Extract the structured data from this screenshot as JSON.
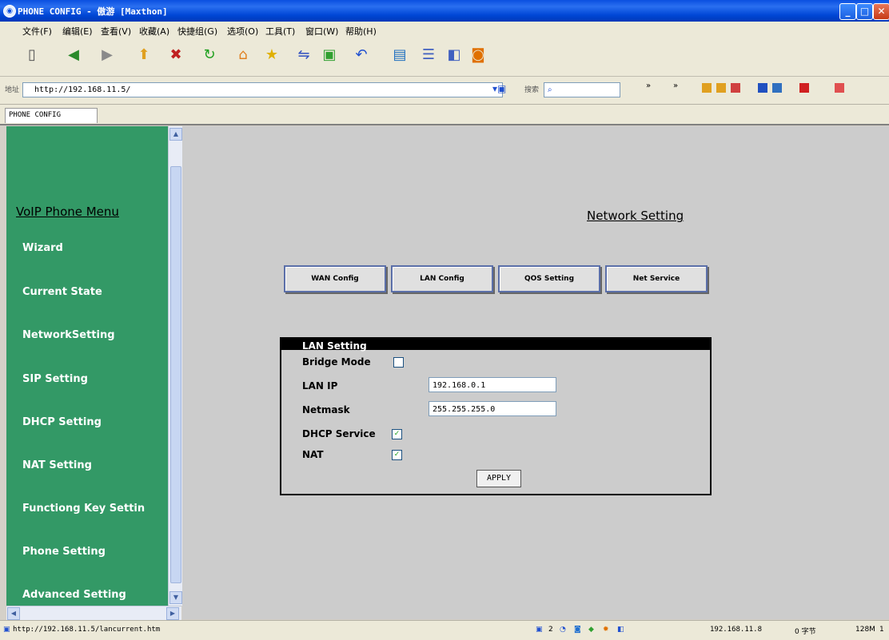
{
  "window": {
    "title": "PHONE CONFIG - 傲游 [Maxthon]"
  },
  "menu": [
    "文件(F)",
    "编辑(E)",
    "查看(V)",
    "收藏(A)",
    "快捷组(G)",
    "选项(O)",
    "工具(T)",
    "窗口(W)",
    "帮助(H)"
  ],
  "address": {
    "label": "地址",
    "url": "http://192.168.11.5/",
    "search_label": "搜索"
  },
  "tab": {
    "label": "PHONE CONFIG"
  },
  "sidebar": {
    "title": "VoIP Phone Menu",
    "items": [
      "Wizard",
      "Current State",
      "NetworkSetting",
      "SIP Setting",
      "DHCP Setting",
      "NAT Setting",
      "Functiong Key Settin",
      "Phone Setting",
      "Advanced Setting"
    ]
  },
  "content": {
    "page_title": "Network Setting",
    "tabs": [
      "WAN Config",
      "LAN Config",
      "QOS Setting",
      "Net Service"
    ],
    "lan": {
      "header": "LAN Setting",
      "bridge_label": "Bridge Mode",
      "bridge_checked": false,
      "ip_label": "LAN IP",
      "ip_value": "192.168.0.1",
      "mask_label": "Netmask",
      "mask_value": "255.255.255.0",
      "dhcp_label": "DHCP Service",
      "dhcp_checked": true,
      "nat_label": "NAT",
      "nat_checked": true,
      "apply_label": "APPLY"
    }
  },
  "status": {
    "url": "http://192.168.11.5/lancurrent.htm",
    "count": "2",
    "ip": "192.168.11.8",
    "bytes": "0 字节",
    "mem": "128M",
    "page": "1"
  }
}
